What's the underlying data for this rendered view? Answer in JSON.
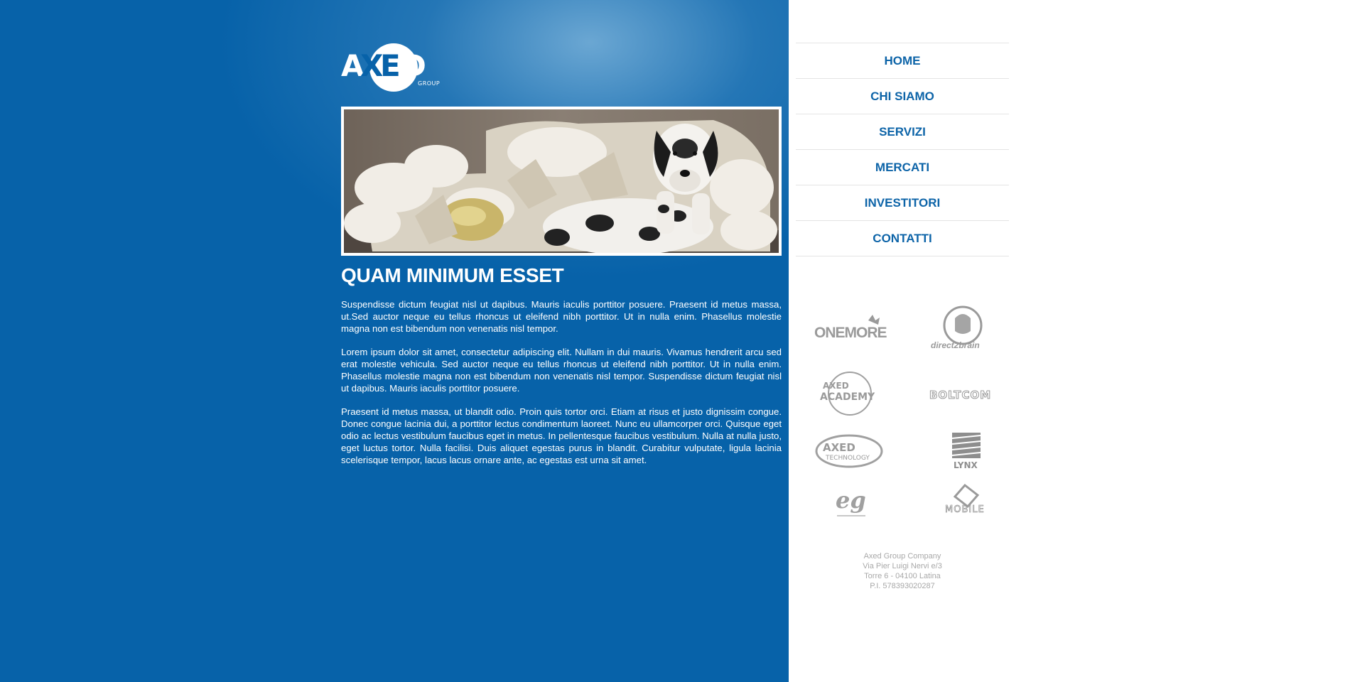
{
  "brand": {
    "logo_text": "AXED",
    "logo_sub": "GROUP"
  },
  "hero": {
    "image_alt": "Great Dane on destroyed sofa"
  },
  "main": {
    "title": "QUAM MINIMUM ESSET",
    "paragraphs": [
      "Suspendisse dictum feugiat nisl ut dapibus. Mauris iaculis porttitor posuere. Praesent id metus massa, ut.Sed auctor neque eu tellus rhoncus ut eleifend nibh porttitor. Ut in nulla enim. Phasellus molestie magna non est bibendum non venenatis nisl tempor.",
      "Lorem ipsum dolor sit amet, consectetur adipiscing elit. Nullam in dui mauris. Vivamus hendrerit arcu sed erat molestie vehicula. Sed auctor neque eu tellus rhoncus ut eleifend nibh porttitor. Ut in nulla enim. Phasellus molestie magna non est bibendum non venenatis nisl tempor. Suspendisse dictum feugiat nisl ut dapibus. Mauris iaculis porttitor posuere.",
      "Praesent id metus massa, ut blandit odio. Proin quis tortor orci. Etiam at risus et justo dignissim congue. Donec congue lacinia dui, a porttitor lectus condimentum laoreet. Nunc eu ullamcorper orci. Quisque eget odio ac lectus vestibulum faucibus eget in metus. In pellentesque faucibus vestibulum. Nulla at nulla justo, eget luctus tortor. Nulla facilisi. Duis aliquet egestas purus in blandit. Curabitur vulputate, ligula lacinia scelerisque tempor, lacus lacus ornare ante, ac egestas est urna sit amet."
    ]
  },
  "nav": {
    "items": [
      {
        "label": "HOME"
      },
      {
        "label": "CHI SIAMO"
      },
      {
        "label": "SERVIZI"
      },
      {
        "label": "MERCATI"
      },
      {
        "label": "INVESTITORI"
      },
      {
        "label": "CONTATTI"
      }
    ]
  },
  "partners": {
    "logos": [
      {
        "name": "ONEMORE"
      },
      {
        "name": "direct2brain"
      },
      {
        "name": "AXED ACADEMY"
      },
      {
        "name": "BOLTCOM"
      },
      {
        "name": "AXED TECHNOLOGY"
      },
      {
        "name": "LYNX"
      },
      {
        "name": "eg"
      },
      {
        "name": "MOBILE"
      }
    ]
  },
  "footer": {
    "lines": [
      "Axed Group Company",
      "Via Pier Luigi Nervi e/3",
      "Torre 6 - 04100 Latina",
      "P.I. 578393020287"
    ]
  },
  "colors": {
    "panel_blue": "#0762a9",
    "nav_blue": "#0d64a8",
    "partner_gray": "#a0a0a0",
    "footer_gray": "#a8a8a8"
  }
}
